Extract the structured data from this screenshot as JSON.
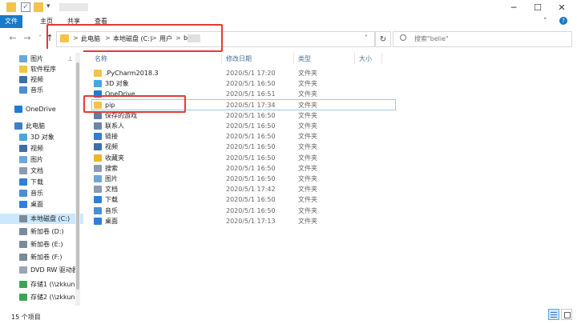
{
  "window": {
    "title": "",
    "minimize_glyph": "─",
    "maximize_glyph": "☐",
    "close_glyph": "✕"
  },
  "ribbon": {
    "tabs": [
      "文件",
      "主页",
      "共享",
      "查看"
    ]
  },
  "nav": {
    "back_glyph": "←",
    "forward_glyph": "→",
    "recent_glyph": "˅",
    "up_glyph": "↑",
    "dropdown_glyph": "˅",
    "refresh_glyph": "↻"
  },
  "address": {
    "crumbs": [
      "此电脑",
      "本地磁盘 (C:)",
      "用户",
      "b"
    ],
    "separator": ">"
  },
  "search": {
    "placeholder": "搜索\"belie\""
  },
  "sidebar": {
    "items": [
      {
        "label": "图片",
        "icon": "pictures-icon",
        "color": "#6ea6d9",
        "pinned": true
      },
      {
        "label": "软件程序",
        "icon": "folder-icon",
        "color": "#f3c34a"
      },
      {
        "label": "视频",
        "icon": "videos-icon",
        "color": "#3c6ea8"
      },
      {
        "label": "音乐",
        "icon": "music-icon",
        "color": "#4a8fd6"
      },
      {
        "label": "OneDrive",
        "icon": "onedrive-icon",
        "color": "#1e7bd9"
      },
      {
        "label": "此电脑",
        "icon": "this-pc-icon",
        "color": "#3f7fc4"
      },
      {
        "label": "3D 对象",
        "icon": "3d-objects-icon",
        "color": "#46a6e0"
      },
      {
        "label": "视频",
        "icon": "videos-icon",
        "color": "#3c6ea8"
      },
      {
        "label": "图片",
        "icon": "pictures-icon",
        "color": "#6ea6d9"
      },
      {
        "label": "文档",
        "icon": "documents-icon",
        "color": "#8d9bb0"
      },
      {
        "label": "下载",
        "icon": "downloads-icon",
        "color": "#2f7ed8"
      },
      {
        "label": "音乐",
        "icon": "music-icon",
        "color": "#4a8fd6"
      },
      {
        "label": "桌面",
        "icon": "desktop-icon",
        "color": "#2f7ed8"
      },
      {
        "label": "本地磁盘 (C:)",
        "icon": "drive-icon",
        "color": "#7a8a99",
        "selected": true
      },
      {
        "label": "新加卷 (D:)",
        "icon": "drive-icon",
        "color": "#7a8a99"
      },
      {
        "label": "新加卷 (E:)",
        "icon": "drive-icon",
        "color": "#7a8a99"
      },
      {
        "label": "新加卷 (F:)",
        "icon": "drive-icon",
        "color": "#7a8a99"
      },
      {
        "label": "DVD RW 驱动器",
        "icon": "dvd-icon",
        "color": "#9aa6b2"
      },
      {
        "label": "存储1 (\\\\zkkun)",
        "icon": "network-drive-icon",
        "color": "#3aa655"
      },
      {
        "label": "存储2 (\\\\zkkun)",
        "icon": "network-drive-icon",
        "color": "#3aa655"
      }
    ]
  },
  "columns": {
    "name": "名称",
    "date": "修改日期",
    "type": "类型",
    "size": "大小"
  },
  "files": [
    {
      "name": ".PyCharm2018.3",
      "date": "2020/5/1 17:20",
      "type": "文件夹",
      "icon": "folder-icon",
      "color": "#f3c34a"
    },
    {
      "name": "3D 对象",
      "date": "2020/5/1 16:50",
      "type": "文件夹",
      "icon": "3d-objects-icon",
      "color": "#46a6e0"
    },
    {
      "name": "OneDrive",
      "date": "2020/5/1 16:51",
      "type": "文件夹",
      "icon": "onedrive-icon",
      "color": "#1e7bd9"
    },
    {
      "name": "pip",
      "date": "2020/5/1 17:34",
      "type": "文件夹",
      "icon": "folder-icon",
      "color": "#f3c34a",
      "selected": true
    },
    {
      "name": "保存的游戏",
      "date": "2020/5/1 16:50",
      "type": "文件夹",
      "icon": "saved-games-icon",
      "color": "#5b7fa6"
    },
    {
      "name": "联系人",
      "date": "2020/5/1 16:50",
      "type": "文件夹",
      "icon": "contacts-icon",
      "color": "#6b86a8"
    },
    {
      "name": "链接",
      "date": "2020/5/1 16:50",
      "type": "文件夹",
      "icon": "links-icon",
      "color": "#2f7ed8"
    },
    {
      "name": "视频",
      "date": "2020/5/1 16:50",
      "type": "文件夹",
      "icon": "videos-icon",
      "color": "#3c6ea8"
    },
    {
      "name": "收藏夹",
      "date": "2020/5/1 16:50",
      "type": "文件夹",
      "icon": "favorites-icon",
      "color": "#f0b429"
    },
    {
      "name": "搜索",
      "date": "2020/5/1 16:50",
      "type": "文件夹",
      "icon": "searches-icon",
      "color": "#8d9bb0"
    },
    {
      "name": "图片",
      "date": "2020/5/1 16:50",
      "type": "文件夹",
      "icon": "pictures-icon",
      "color": "#6ea6d9"
    },
    {
      "name": "文档",
      "date": "2020/5/1 17:42",
      "type": "文件夹",
      "icon": "documents-icon",
      "color": "#8d9bb0"
    },
    {
      "name": "下载",
      "date": "2020/5/1 16:50",
      "type": "文件夹",
      "icon": "downloads-icon",
      "color": "#2f7ed8"
    },
    {
      "name": "音乐",
      "date": "2020/5/1 16:50",
      "type": "文件夹",
      "icon": "music-icon",
      "color": "#4a8fd6"
    },
    {
      "name": "桌面",
      "date": "2020/5/1 17:13",
      "type": "文件夹",
      "icon": "desktop-icon",
      "color": "#2f7ed8"
    }
  ],
  "status": {
    "item_count": "15 个项目"
  },
  "colors": {
    "accent": "#1979ca",
    "annotation_red": "#e53935",
    "selection_border": "#99c9ef",
    "header_text": "#4a6f99"
  }
}
